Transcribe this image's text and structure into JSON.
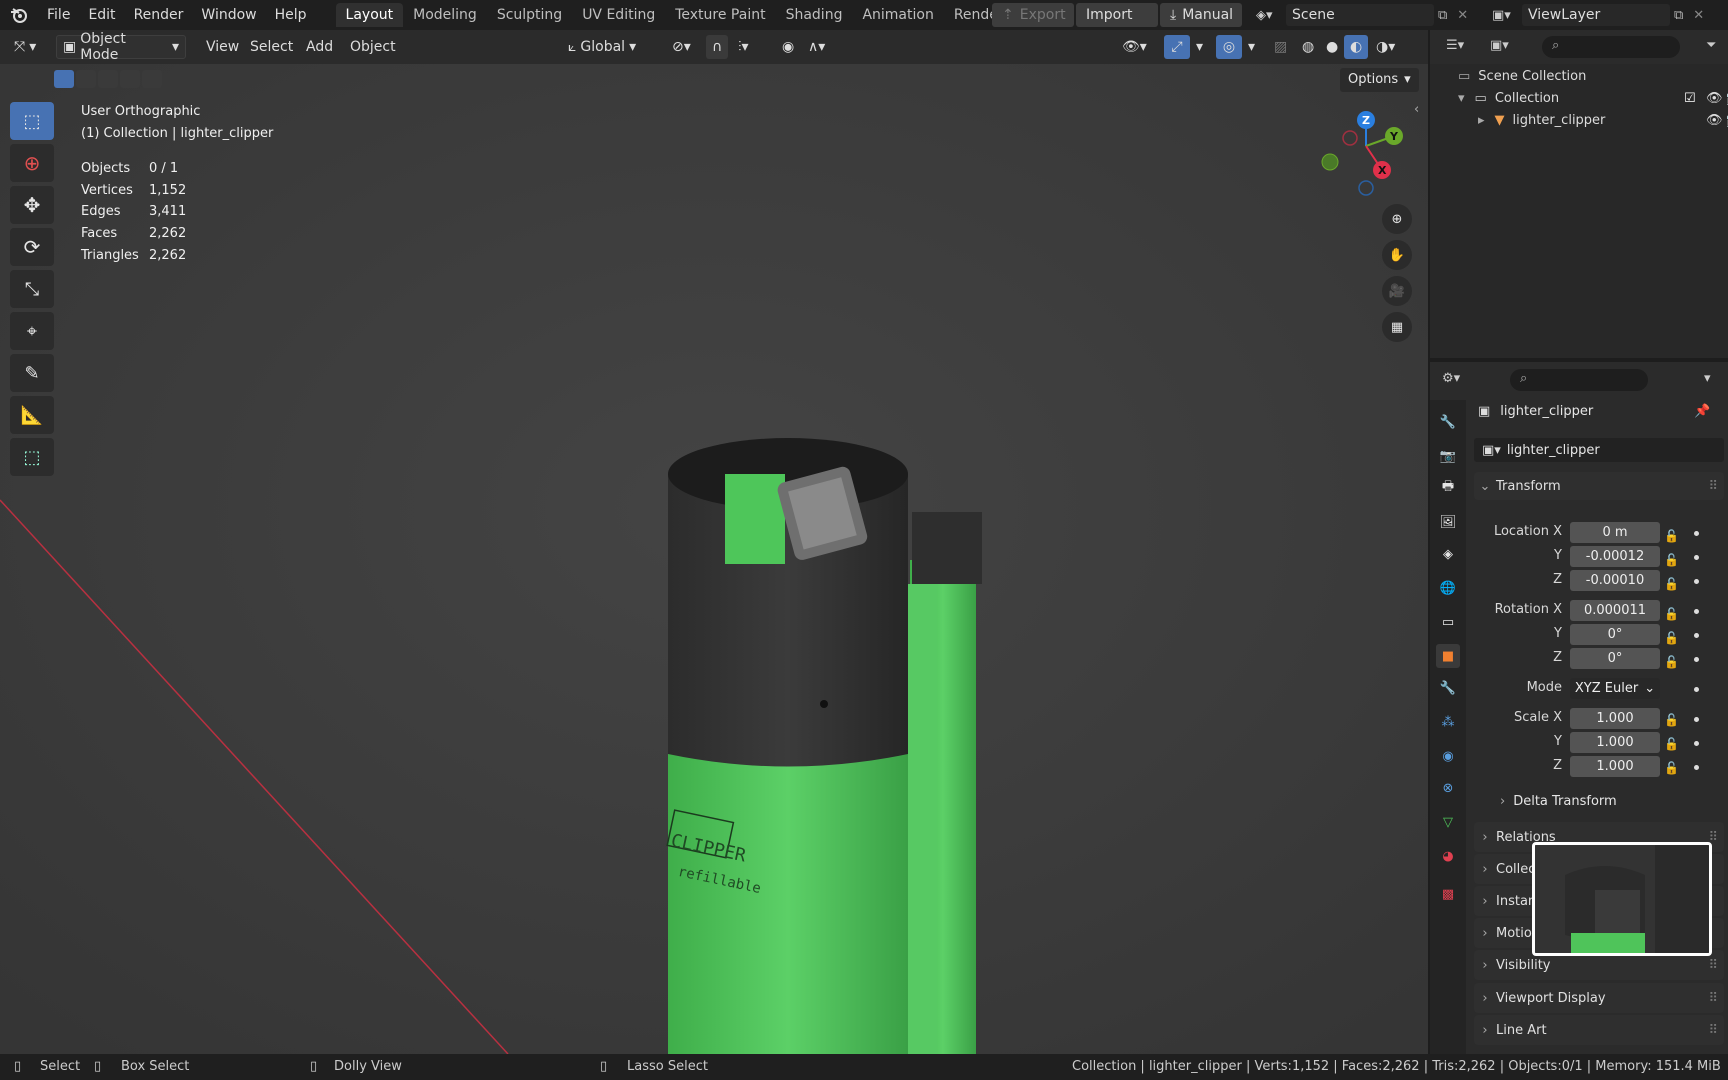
{
  "topbar": {
    "menus": [
      "File",
      "Edit",
      "Render",
      "Window",
      "Help"
    ],
    "workspaces": [
      "Layout",
      "Modeling",
      "Sculpting",
      "UV Editing",
      "Texture Paint",
      "Shading",
      "Animation",
      "Rendering"
    ],
    "active_workspace": "Layout",
    "export_label": "Export",
    "import_label": "Import",
    "manual_label": "Manual",
    "scene": "Scene",
    "view_layer": "ViewLayer"
  },
  "viewport_header": {
    "mode": "Object Mode",
    "menus": [
      "View",
      "Select",
      "Add",
      "Object"
    ],
    "orientation": "Global",
    "options_label": "Options"
  },
  "viewport": {
    "view_name": "User Orthographic",
    "collection_line": "(1) Collection | lighter_clipper",
    "stats": [
      {
        "k": "Objects",
        "v": "0 / 1"
      },
      {
        "k": "Vertices",
        "v": "1,152"
      },
      {
        "k": "Edges",
        "v": "3,411"
      },
      {
        "k": "Faces",
        "v": "2,262"
      },
      {
        "k": "Triangles",
        "v": "2,262"
      }
    ],
    "gizmo": {
      "z": "Z",
      "y": "Y",
      "x": "X"
    },
    "lighter": {
      "brand": "CLIPPER",
      "subtext": "refillable"
    }
  },
  "outliner": {
    "scene_collection": "Scene Collection",
    "collection": "Collection",
    "object": "lighter_clipper"
  },
  "properties": {
    "object_name": "lighter_clipper",
    "datablock_name": "lighter_clipper",
    "transform_label": "Transform",
    "location_label": "Location X",
    "rotation_label": "Rotation X",
    "scale_label": "Scale X",
    "y_label": "Y",
    "z_label": "Z",
    "mode_label": "Mode",
    "location": [
      "0 m",
      "-0.00012",
      "-0.00010"
    ],
    "rotation": [
      "0.000011",
      "0°",
      "0°"
    ],
    "rotation_mode": "XYZ Euler",
    "scale": [
      "1.000",
      "1.000",
      "1.000"
    ],
    "delta_transform": "Delta Transform",
    "panels": [
      "Relations",
      "Collections",
      "Instancing",
      "Motion Paths",
      "Visibility",
      "Viewport Display",
      "Line Art"
    ]
  },
  "statusbar": {
    "select": "Select",
    "box_select": "Box Select",
    "dolly": "Dolly View",
    "lasso": "Lasso Select",
    "info": "Collection | lighter_clipper | Verts:1,152 | Faces:2,262 | Tris:2,262 | Objects:0/1 | Memory: 151.4 MiB"
  },
  "colors": {
    "accent": "#4772b3",
    "viewport_bg": "#3a3a3a",
    "lighter_green": "#4fc45a",
    "x_axis": "#e0304a",
    "y_axis": "#6aa82a",
    "z_axis": "#2a7fe0"
  }
}
